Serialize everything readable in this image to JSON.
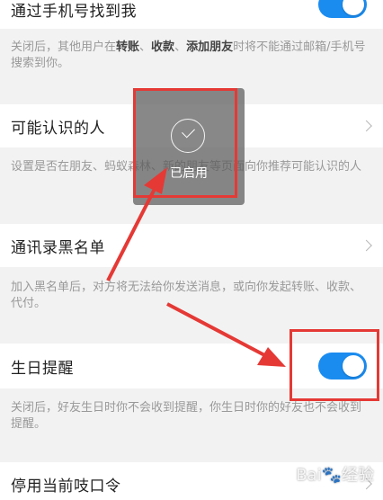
{
  "settings": {
    "find_by_phone": {
      "title": "通过手机号找到我",
      "desc_before": "关闭后，其他用户在",
      "desc_bold_1": "转账",
      "desc_sep_1": "、",
      "desc_bold_2": "收款",
      "desc_sep_2": "、",
      "desc_bold_3": "添加朋友",
      "desc_after": "时将不能通过邮箱/手机号搜索到你。",
      "enabled": true
    },
    "may_know": {
      "title": "可能认识的人",
      "desc": "设置是否在朋友、蚂蚁森林、新的朋友等页面向你推荐可能认识的人"
    },
    "blacklist": {
      "title": "通讯录黑名单",
      "desc": "加入黑名单后，对方将无法给你发送消息，或向你发起转账、收款、代付。"
    },
    "birthday": {
      "title": "生日提醒",
      "desc": "关闭后，好友生日时你不会收到提醒，你生日时你的好友也不会收到提醒。",
      "enabled": true
    },
    "password": {
      "title": "停用当前吱口令"
    }
  },
  "toast": {
    "text": "已启用"
  },
  "watermark": "Bai🐾经验",
  "colors": {
    "toggle_on": "#1a8cf0",
    "annotation": "#e53935"
  }
}
